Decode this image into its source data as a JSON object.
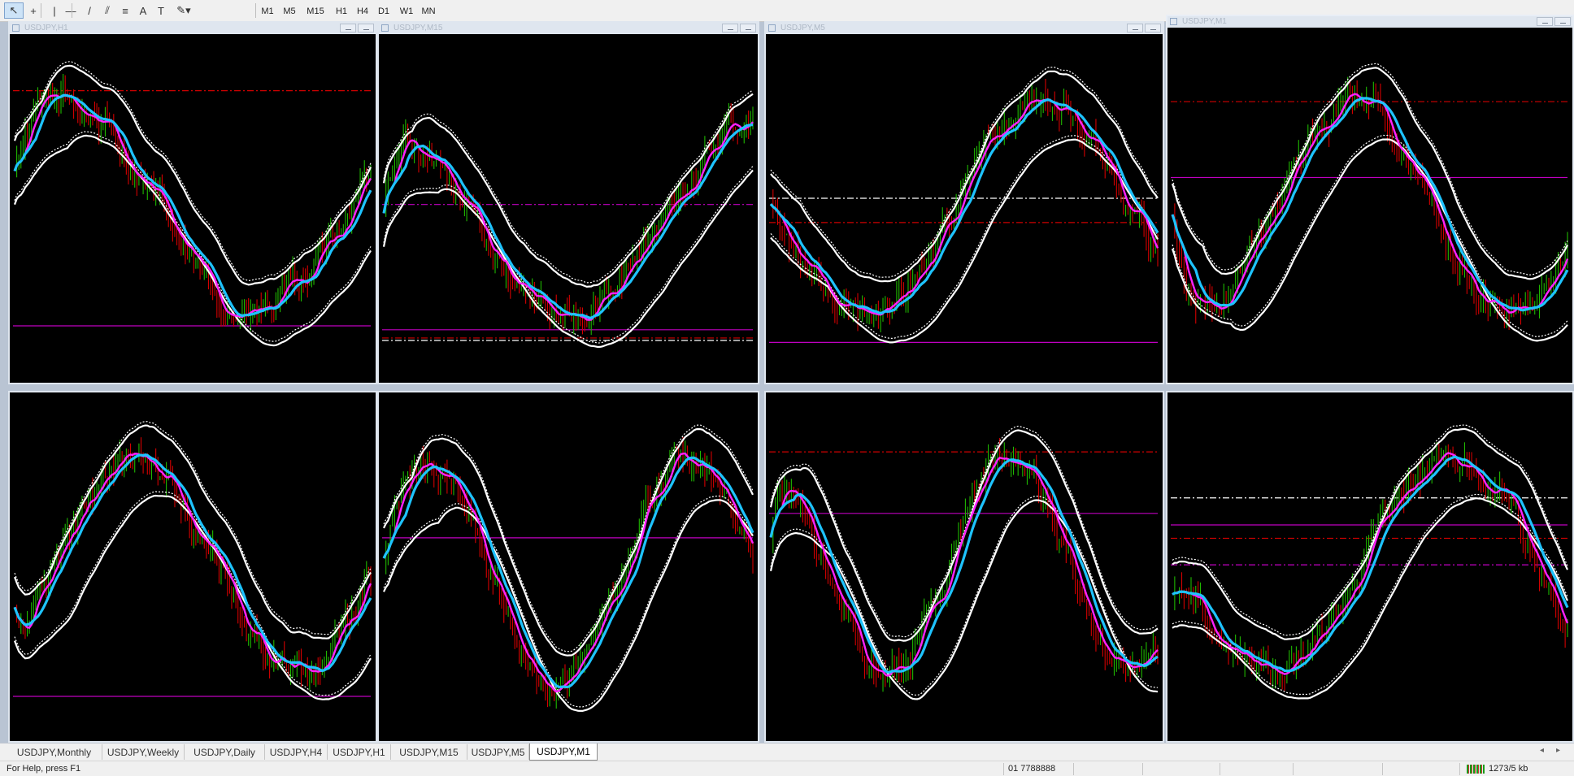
{
  "toolbar": {
    "tools": [
      {
        "name": "cursor-icon",
        "glyph": "↖"
      },
      {
        "name": "crosshair-icon",
        "glyph": "+"
      },
      {
        "name": "vertical-line-icon",
        "glyph": "|"
      },
      {
        "name": "horizontal-line-icon",
        "glyph": "—"
      },
      {
        "name": "trendline-icon",
        "glyph": "/"
      },
      {
        "name": "equidistant-channel-icon",
        "glyph": "⫽"
      },
      {
        "name": "fibonacci-icon",
        "glyph": "≡"
      },
      {
        "name": "text-icon",
        "glyph": "A"
      },
      {
        "name": "text-label-icon",
        "glyph": "T"
      },
      {
        "name": "shapes-dropdown-icon",
        "glyph": "✎▾"
      }
    ],
    "timeframes": [
      "M1",
      "M5",
      "M15",
      "H1",
      "H4",
      "D1",
      "W1",
      "MN"
    ]
  },
  "charts": [
    {
      "title": "USDJPY,H1",
      "active": false
    },
    {
      "title": "USDJPY,M15",
      "active": false
    },
    {
      "title": "USDJPY,M5",
      "active": false
    },
    {
      "title": "USDJPY,M1",
      "active": true
    },
    {
      "title": "",
      "active": false
    },
    {
      "title": "",
      "active": false
    },
    {
      "title": "",
      "active": false
    },
    {
      "title": "",
      "active": false
    }
  ],
  "colors": {
    "background": "#000000",
    "bull_candle": "#1fb800",
    "bear_candle": "#d40000",
    "fast_ma": "#ff22ff",
    "slow_ma": "#1ec3ff",
    "bands": "#ffffff",
    "level_magenta": "#c000c0",
    "level_red": "#d00000",
    "level_white": "#ffffff"
  },
  "tabs": [
    "USDJPY,Monthly",
    "USDJPY,Weekly",
    "USDJPY,Daily",
    "USDJPY,H4",
    "USDJPY,H1",
    "USDJPY,M15",
    "USDJPY,M5",
    "USDJPY,M1"
  ],
  "active_tab": "USDJPY,M1",
  "status": {
    "help": "For Help, press F1",
    "value": "01 7788888",
    "traffic": "1273/5 kb"
  }
}
